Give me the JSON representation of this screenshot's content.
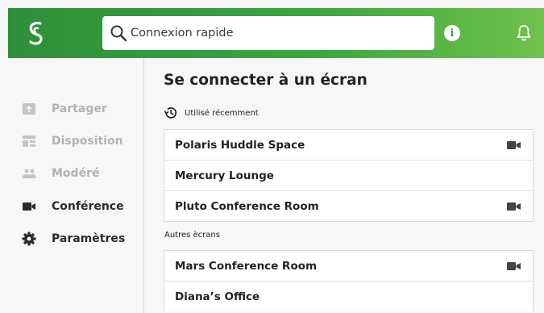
{
  "header": {
    "search_placeholder": "Connexion rapide",
    "info_label": "i",
    "colors": {
      "brand_green": "#3aa53f",
      "brand_light": "#71c24f"
    }
  },
  "sidebar": {
    "items": [
      {
        "label": "Partager",
        "icon": "share-screen-icon",
        "enabled": false
      },
      {
        "label": "Disposition",
        "icon": "layout-icon",
        "enabled": false
      },
      {
        "label": "Modéré",
        "icon": "moderated-people-icon",
        "enabled": false
      },
      {
        "label": "Conférence",
        "icon": "video-camera-icon",
        "enabled": true
      },
      {
        "label": "Paramètres",
        "icon": "gear-icon",
        "enabled": true
      }
    ]
  },
  "main": {
    "title": "Se connecter à un écran",
    "recent": {
      "label": "Utilisé récemment",
      "rooms": [
        {
          "name": "Polaris Huddle Space",
          "conference": true
        },
        {
          "name": "Mercury Lounge",
          "conference": false
        },
        {
          "name": "Pluto Conference Room",
          "conference": true
        }
      ]
    },
    "others": {
      "label": "Autres ècrans",
      "rooms": [
        {
          "name": "Mars Conference Room",
          "conference": true
        },
        {
          "name": "Diana’s Office",
          "conference": false
        }
      ]
    }
  }
}
